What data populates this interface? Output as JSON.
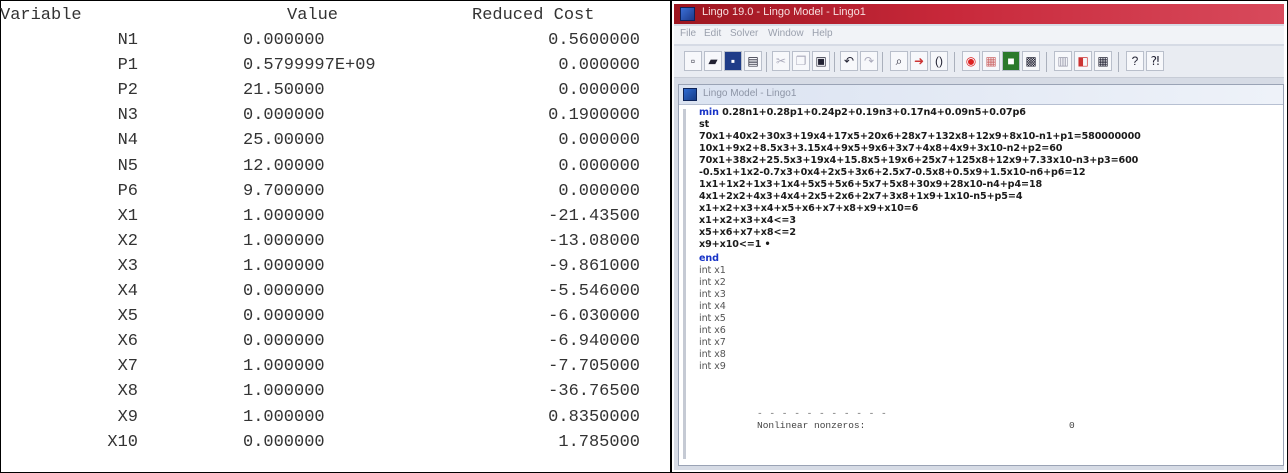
{
  "report": {
    "headers": {
      "variable": "Variable",
      "value": "Value",
      "reduced_cost": "Reduced Cost"
    },
    "rows": [
      {
        "variable": "N1",
        "value": "0.000000",
        "reduced_cost": "0.5600000"
      },
      {
        "variable": "P1",
        "value": "0.5799997E+09",
        "reduced_cost": "0.000000"
      },
      {
        "variable": "P2",
        "value": "21.50000",
        "reduced_cost": "0.000000"
      },
      {
        "variable": "N3",
        "value": "0.000000",
        "reduced_cost": "0.1900000"
      },
      {
        "variable": "N4",
        "value": "25.00000",
        "reduced_cost": "0.000000"
      },
      {
        "variable": "N5",
        "value": "12.00000",
        "reduced_cost": "0.000000"
      },
      {
        "variable": "P6",
        "value": "9.700000",
        "reduced_cost": "0.000000"
      },
      {
        "variable": "X1",
        "value": "1.000000",
        "reduced_cost": "-21.43500"
      },
      {
        "variable": "X2",
        "value": "1.000000",
        "reduced_cost": "-13.08000"
      },
      {
        "variable": "X3",
        "value": "1.000000",
        "reduced_cost": "-9.861000"
      },
      {
        "variable": "X4",
        "value": "0.000000",
        "reduced_cost": "-5.546000"
      },
      {
        "variable": "X5",
        "value": "0.000000",
        "reduced_cost": "-6.030000"
      },
      {
        "variable": "X6",
        "value": "0.000000",
        "reduced_cost": "-6.940000"
      },
      {
        "variable": "X7",
        "value": "1.000000",
        "reduced_cost": "-7.705000"
      },
      {
        "variable": "X8",
        "value": "1.000000",
        "reduced_cost": "-36.76500"
      },
      {
        "variable": "X9",
        "value": "1.000000",
        "reduced_cost": "0.8350000"
      },
      {
        "variable": "X10",
        "value": "0.000000",
        "reduced_cost": "1.785000"
      }
    ]
  },
  "app": {
    "window_title": "Lingo 19.0 - Lingo Model - Lingo1",
    "menu": [
      "File",
      "Edit",
      "Solver",
      "Window",
      "Help"
    ],
    "toolbar_icons": [
      "new-file-icon",
      "open-file-icon",
      "save-icon",
      "print-icon",
      "cut-icon",
      "copy-icon",
      "paste-icon",
      "undo-icon",
      "redo-icon",
      "find-icon",
      "goto-icon",
      "match-paren-icon",
      "solve-icon",
      "solution-icon",
      "matrix-icon",
      "options-icon",
      "tile-icon",
      "cascade-icon",
      "arrange-icon",
      "help-icon",
      "context-help-icon"
    ],
    "model_window_title": "Lingo Model - Lingo1",
    "colors": {
      "titlebar": "#c8283a",
      "keyword": "#1733c7"
    },
    "model_lines": [
      {
        "kw": "min",
        "text": " 0.28n1+0.28p1+0.24p2+0.19n3+0.17n4+0.09n5+0.07p6"
      },
      {
        "kw": "",
        "text": "st"
      },
      {
        "kw": "",
        "text": "70x1+40x2+30x3+19x4+17x5+20x6+28x7+132x8+12x9+8x10-n1+p1=580000000"
      },
      {
        "kw": "",
        "text": "10x1+9x2+8.5x3+3.15x4+9x5+9x6+3x7+4x8+4x9+3x10-n2+p2=60"
      },
      {
        "kw": "",
        "text": "70x1+38x2+25.5x3+19x4+15.8x5+19x6+25x7+125x8+12x9+7.33x10-n3+p3=600"
      },
      {
        "kw": "",
        "text": "-0.5x1+1x2-0.7x3+0x4+2x5+3x6+2.5x7-0.5x8+0.5x9+1.5x10-n6+p6=12"
      },
      {
        "kw": "",
        "text": "1x1+1x2+1x3+1x4+5x5+5x6+5x7+5x8+30x9+28x10-n4+p4=18"
      },
      {
        "kw": "",
        "text": "4x1+2x2+4x3+4x4+2x5+2x6+2x7+3x8+1x9+1x10-n5+p5=4"
      },
      {
        "kw": "",
        "text": "x1+x2+x3+x4+x5+x6+x7+x8+x9+x10=6"
      },
      {
        "kw": "",
        "text": "x1+x2+x3+x4<=3"
      },
      {
        "kw": "",
        "text": "x5+x6+x7+x8<=2"
      },
      {
        "kw": "",
        "text": "x9+x10<=1  •"
      },
      {
        "kw": "end",
        "text": ""
      },
      {
        "kw": "",
        "text": "int x1",
        "faint": true
      },
      {
        "kw": "",
        "text": "int x2",
        "faint": true
      },
      {
        "kw": "",
        "text": "int x3",
        "faint": true
      },
      {
        "kw": "",
        "text": "int x4",
        "faint": true
      },
      {
        "kw": "",
        "text": "int x5",
        "faint": true
      },
      {
        "kw": "",
        "text": "int x6",
        "faint": true
      },
      {
        "kw": "",
        "text": "int x7",
        "faint": true
      },
      {
        "kw": "",
        "text": "int x8",
        "faint": true
      },
      {
        "kw": "",
        "text": "int x9",
        "faint": true
      }
    ],
    "status_label": "Nonlinear nonzeros:",
    "status_value": "0"
  }
}
